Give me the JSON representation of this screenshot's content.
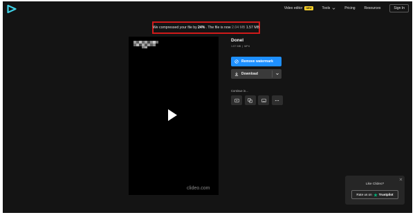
{
  "brand": {
    "logo_icon": "clideo-play-logo-icon",
    "accent": "#3fd1e6"
  },
  "nav": {
    "items": [
      {
        "label": "Video editor",
        "badge": "NEW"
      },
      {
        "label": "Tools",
        "has_dropdown": true
      },
      {
        "label": "Pricing"
      },
      {
        "label": "Resources"
      }
    ],
    "signin_label": "Sign In"
  },
  "notice": {
    "prefix": "We compressed your file by",
    "percent": "24%",
    "middle": ". The file is now",
    "old_size": "2.04 MB",
    "new_size": "1.57 MB",
    "highlight_color": "#d11a1a"
  },
  "video": {
    "watermark": "clideo.com",
    "play_icon": "play-icon"
  },
  "file": {
    "title": "Donel",
    "size": "1.57 MB",
    "separator": "|",
    "format": "MP4"
  },
  "actions": {
    "remove_watermark_label": "Remove watermark",
    "remove_watermark_color": "#1e90ff",
    "download_label": "Download"
  },
  "continue": {
    "label": "Continue in...",
    "tools": [
      {
        "icon": "video-editor-icon"
      },
      {
        "icon": "merge-icon"
      },
      {
        "icon": "subtitles-icon"
      },
      {
        "icon": "more-icon"
      }
    ]
  },
  "rating": {
    "title": "Like Clideo?",
    "button_prefix": "Rate us on",
    "button_brand": "Trustpilot",
    "star_color": "#00b67a"
  }
}
